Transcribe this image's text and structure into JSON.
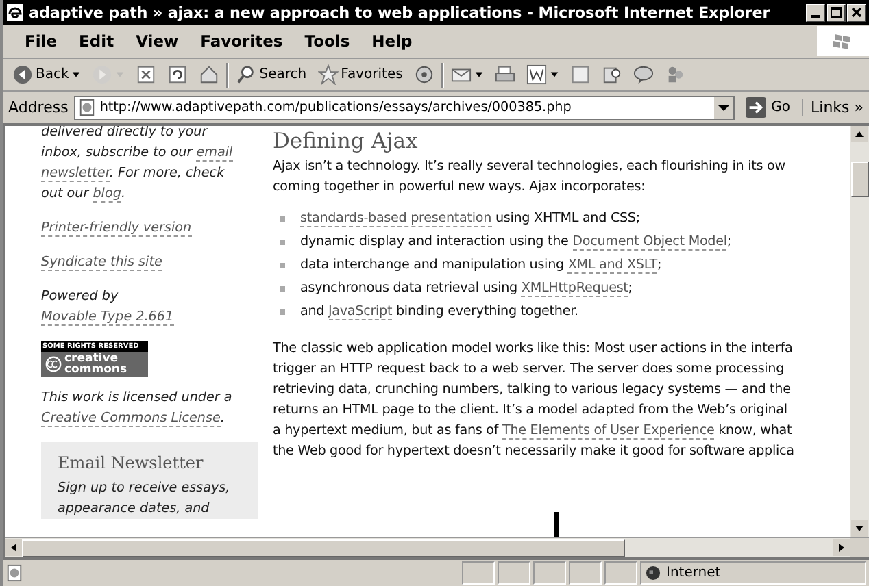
{
  "window": {
    "title": "adaptive path » ajax: a new approach to web applications - Microsoft Internet Explorer"
  },
  "menu": [
    "File",
    "Edit",
    "View",
    "Favorites",
    "Tools",
    "Help"
  ],
  "toolbar": [
    {
      "kind": "back",
      "label": "Back",
      "disabled": false
    },
    {
      "kind": "forward",
      "disabled": true
    },
    {
      "kind": "stop",
      "disabled": false
    },
    {
      "kind": "refresh",
      "disabled": false
    },
    {
      "kind": "home",
      "disabled": false
    },
    {
      "kind": "search",
      "label": "Search",
      "disabled": false
    },
    {
      "kind": "favorites",
      "label": "Favorites",
      "disabled": false
    },
    {
      "kind": "media",
      "disabled": false
    },
    {
      "kind": "mail",
      "disabled": false
    },
    {
      "kind": "print",
      "disabled": false
    },
    {
      "kind": "edit",
      "disabled": false
    },
    {
      "kind": "discuss",
      "disabled": false
    },
    {
      "kind": "research",
      "disabled": false
    },
    {
      "kind": "messenger",
      "disabled": false
    },
    {
      "kind": "people",
      "disabled": false
    }
  ],
  "address": {
    "label": "Address",
    "value": "http://www.adaptivepath.com/publications/essays/archives/000385.php",
    "go": "Go",
    "links": "Links »"
  },
  "sidebar": {
    "blocks": [
      {
        "lines": [
          [
            {
              "t": "delivered directly to your",
              "link": false
            }
          ],
          [
            {
              "t": "inbox, subscribe to our ",
              "link": false
            },
            {
              "t": "email",
              "link": true
            }
          ],
          [
            {
              "t": "newsletter",
              "link": true
            },
            {
              "t": ". For more, check",
              "link": false
            }
          ],
          [
            {
              "t": "out our ",
              "link": false
            },
            {
              "t": "blog",
              "link": true
            },
            {
              "t": ".",
              "link": false
            }
          ]
        ]
      },
      {
        "lines": [
          [
            {
              "t": "Printer-friendly version",
              "link": true
            }
          ]
        ]
      },
      {
        "lines": [
          [
            {
              "t": "Syndicate this site",
              "link": true
            }
          ]
        ]
      },
      {
        "lines": [
          [
            {
              "t": "Powered by",
              "link": false
            }
          ],
          [
            {
              "t": "Movable Type 2.661",
              "link": true
            }
          ]
        ]
      }
    ],
    "badge": {
      "top": "SOME RIGHTS RESERVED",
      "bottom": "creative commons"
    },
    "license": [
      [
        {
          "t": "This work is licensed under a",
          "link": false
        }
      ],
      [
        {
          "t": "Creative Commons License",
          "link": true
        },
        {
          "t": ".",
          "link": false
        }
      ]
    ],
    "newsletter": {
      "title": "Email Newsletter",
      "lines": [
        "Sign up to receive essays,",
        "appearance dates, and"
      ]
    }
  },
  "article": {
    "heading": "Defining Ajax",
    "intro": [
      [
        {
          "t": "Ajax isn’t a technology. It’s really several technologies, each flourishing in its ow",
          "link": false
        }
      ],
      [
        {
          "t": "coming together in powerful new ways. Ajax incorporates:",
          "link": false
        }
      ]
    ],
    "bullets": [
      [
        {
          "t": "standards-based presentation",
          "link": true
        },
        {
          "t": " using XHTML and CSS;",
          "link": false
        }
      ],
      [
        {
          "t": "dynamic display and interaction using the ",
          "link": false
        },
        {
          "t": "Document Object Model",
          "link": true
        },
        {
          "t": ";",
          "link": false
        }
      ],
      [
        {
          "t": "data interchange and manipulation using ",
          "link": false
        },
        {
          "t": "XML and XSLT",
          "link": true
        },
        {
          "t": ";",
          "link": false
        }
      ],
      [
        {
          "t": "asynchronous data retrieval using ",
          "link": false
        },
        {
          "t": "XMLHttpRequest",
          "link": true
        },
        {
          "t": ";",
          "link": false
        }
      ],
      [
        {
          "t": "and ",
          "link": false
        },
        {
          "t": "JavaScript",
          "link": true
        },
        {
          "t": " binding everything together.",
          "link": false
        }
      ]
    ],
    "paragraph": [
      [
        {
          "t": "The classic web application model works like this: Most user actions in the interfa",
          "link": false
        }
      ],
      [
        {
          "t": "trigger an HTTP request back to a web server. The server does some processing",
          "link": false
        }
      ],
      [
        {
          "t": "retrieving data, crunching numbers, talking to various legacy systems — and the",
          "link": false
        }
      ],
      [
        {
          "t": "returns an HTML page to the client. It’s a model adapted from the Web’s original",
          "link": false
        }
      ],
      [
        {
          "t": "a hypertext medium, but as fans of ",
          "link": false
        },
        {
          "t": "The Elements of User Experience",
          "link": true
        },
        {
          "t": " know, what",
          "link": false
        }
      ],
      [
        {
          "t": "the Web good for hypertext doesn’t necessarily make it good for software applica",
          "link": false
        }
      ]
    ]
  },
  "status_bar": {
    "zone": "Internet"
  }
}
